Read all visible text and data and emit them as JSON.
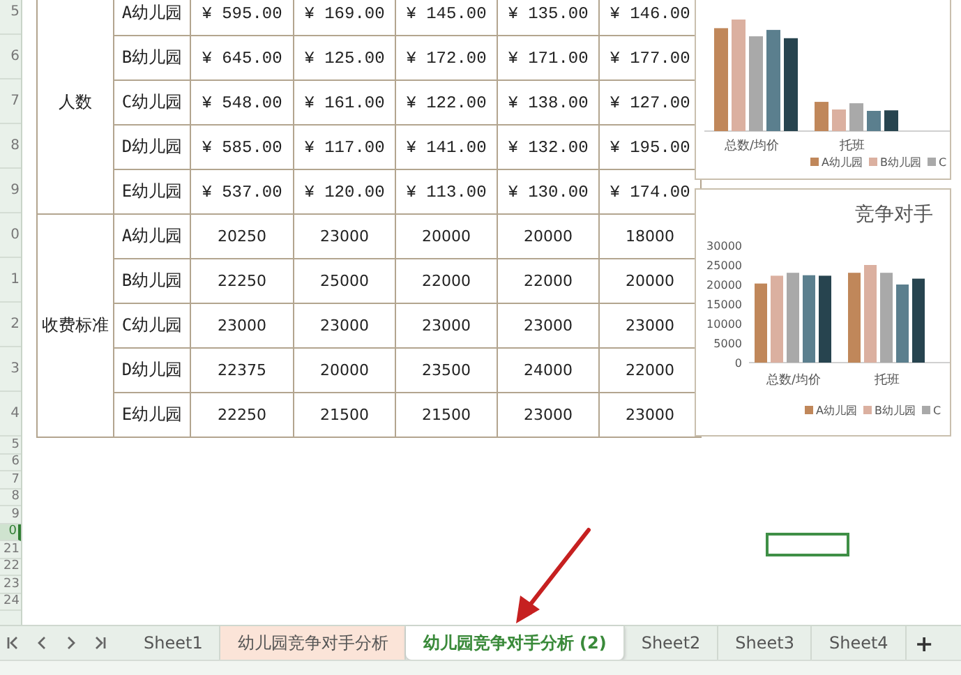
{
  "row_numbers": [
    {
      "label": "5",
      "selected": false
    },
    {
      "label": "6",
      "selected": false
    },
    {
      "label": "7",
      "selected": false
    },
    {
      "label": "8",
      "selected": false
    },
    {
      "label": "9",
      "selected": false
    },
    {
      "label": "0",
      "selected": false
    },
    {
      "label": "1",
      "selected": false
    },
    {
      "label": "2",
      "selected": false
    },
    {
      "label": "3",
      "selected": false
    },
    {
      "label": "4",
      "selected": false
    },
    {
      "label": "5",
      "selected": false
    },
    {
      "label": "6",
      "selected": false
    },
    {
      "label": "7",
      "selected": false
    },
    {
      "label": "8",
      "selected": false
    },
    {
      "label": "9",
      "selected": false
    },
    {
      "label": "0",
      "selected": true
    },
    {
      "label": "21",
      "selected": false
    },
    {
      "label": "22",
      "selected": false
    },
    {
      "label": "23",
      "selected": false
    },
    {
      "label": "24",
      "selected": false
    }
  ],
  "table": {
    "groups": [
      {
        "label": "人数",
        "rows": [
          {
            "name": "A幼儿园",
            "cells": [
              "¥ 595.00",
              "¥ 169.00",
              "¥ 145.00",
              "¥ 135.00",
              "¥ 146.00"
            ]
          },
          {
            "name": "B幼儿园",
            "cells": [
              "¥ 645.00",
              "¥ 125.00",
              "¥ 172.00",
              "¥ 171.00",
              "¥ 177.00"
            ]
          },
          {
            "name": "C幼儿园",
            "cells": [
              "¥ 548.00",
              "¥ 161.00",
              "¥ 122.00",
              "¥ 138.00",
              "¥ 127.00"
            ]
          },
          {
            "name": "D幼儿园",
            "cells": [
              "¥ 585.00",
              "¥ 117.00",
              "¥ 141.00",
              "¥ 132.00",
              "¥ 195.00"
            ]
          },
          {
            "name": "E幼儿园",
            "cells": [
              "¥ 537.00",
              "¥ 120.00",
              "¥ 113.00",
              "¥ 130.00",
              "¥ 174.00"
            ]
          }
        ]
      },
      {
        "label": "收费标准",
        "rows": [
          {
            "name": "A幼儿园",
            "cells": [
              "20250",
              "23000",
              "20000",
              "20000",
              "18000"
            ]
          },
          {
            "name": "B幼儿园",
            "cells": [
              "22250",
              "25000",
              "22000",
              "22000",
              "20000"
            ]
          },
          {
            "name": "C幼儿园",
            "cells": [
              "23000",
              "23000",
              "23000",
              "23000",
              "23000"
            ]
          },
          {
            "name": "D幼儿园",
            "cells": [
              "22375",
              "20000",
              "23500",
              "24000",
              "22000"
            ]
          },
          {
            "name": "E幼儿园",
            "cells": [
              "22250",
              "21500",
              "21500",
              "23000",
              "23000"
            ]
          }
        ]
      }
    ]
  },
  "chart_top": {
    "categories": [
      "总数/均价",
      "托班"
    ],
    "legend": [
      "A幼儿园",
      "B幼儿园",
      "C"
    ]
  },
  "chart_fees": {
    "chart_data": {
      "type": "bar",
      "legend": "bottom",
      "title": "竞争对手",
      "categories": [
        "总数/均价",
        "托班"
      ],
      "ylim": [
        0,
        30000
      ],
      "yticks": [
        0,
        5000,
        10000,
        15000,
        20000,
        25000,
        30000
      ],
      "series": [
        {
          "name": "A幼儿园",
          "color": "#c0875a",
          "values": [
            20250,
            23000
          ]
        },
        {
          "name": "B幼儿园",
          "color": "#dbb0a0",
          "values": [
            22250,
            25000
          ]
        },
        {
          "name": "C",
          "color": "#a9a9a9",
          "values": [
            23000,
            23000
          ]
        },
        {
          "color": "#5b7f8e",
          "values": [
            22375,
            20000
          ]
        },
        {
          "color": "#27444f",
          "values": [
            22250,
            21500
          ]
        }
      ]
    }
  },
  "sheet_tabs": [
    {
      "label": "Sheet1",
      "selected": false
    },
    {
      "label": "幼儿园竞争对手分析",
      "selected": false,
      "color": "#fbe4d8"
    },
    {
      "label": "幼儿园竞争对手分析 (2)",
      "selected": true
    },
    {
      "label": "Sheet2",
      "selected": false
    },
    {
      "label": "Sheet3",
      "selected": false
    },
    {
      "label": "Sheet4",
      "selected": false
    }
  ],
  "add_sheet": "+"
}
